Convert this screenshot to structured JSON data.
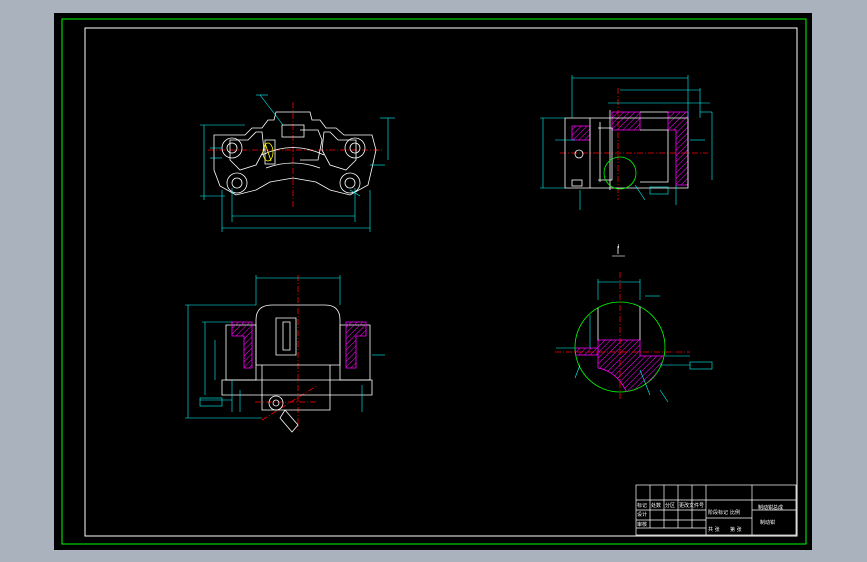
{
  "viewport": {
    "background": "#000000",
    "frame_background": "#a9b2bd"
  },
  "colors": {
    "outer_border": "#00ff00",
    "inner_border": "#ffffff",
    "outline": "#ffffff",
    "dimension": "#00ffff",
    "centerline": "#ff0000",
    "hatch": "#ff00ff",
    "hidden": "#ffff00",
    "detail_circle": "#00ff00"
  },
  "views": [
    {
      "id": "front-view",
      "label": ""
    },
    {
      "id": "side-section-view",
      "label": "I"
    },
    {
      "id": "top-view",
      "label": ""
    },
    {
      "id": "detail-view",
      "label": "I"
    }
  ],
  "title_block": {
    "drawing_title": "制动钳总成",
    "drawing_number": "制动钳",
    "cells": [
      "标记",
      "处数",
      "分区",
      "更改文件号",
      "签名",
      "年月日",
      "设计",
      "标准化",
      "审核",
      "工艺",
      "批准",
      "阶段标记",
      "重量",
      "比例",
      "共 张",
      "第 张"
    ]
  }
}
